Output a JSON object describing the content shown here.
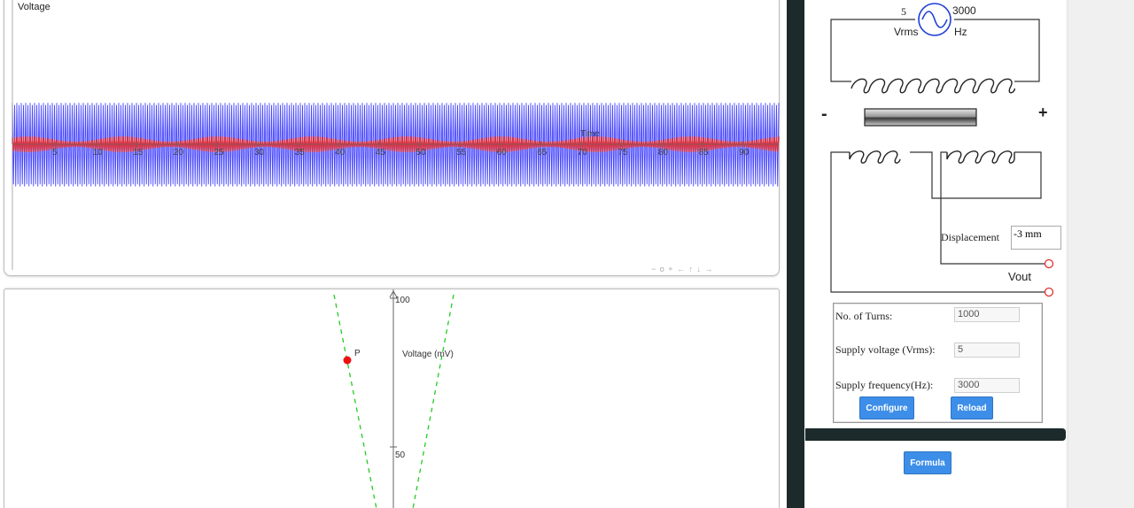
{
  "top_plot": {
    "title": "Voltage",
    "x_axis_label": "Time",
    "x_ticks": [
      "5",
      "10",
      "15",
      "20",
      "25",
      "30",
      "35",
      "40",
      "45",
      "50",
      "55",
      "60",
      "65",
      "70",
      "75",
      "80",
      "85",
      "90"
    ],
    "nav_controls": "− o + ← ↑ ↓ →"
  },
  "bottom_plot": {
    "y_axis_label": "Voltage (mV)",
    "y_ticks": [
      "100",
      "50"
    ],
    "point_label": "P"
  },
  "circuit": {
    "supply_voltage_value": "5",
    "supply_voltage_unit": "Vrms",
    "supply_freq_value": "3000",
    "supply_freq_unit": "Hz",
    "minus_sign": "-",
    "plus_sign": "+",
    "displacement_label": "Displacement",
    "displacement_value": "-3 mm",
    "vout_label": "Vout"
  },
  "config": {
    "turns_label": "No. of Turns:",
    "turns_value": "1000",
    "voltage_label": "Supply voltage (Vrms):",
    "voltage_value": "5",
    "freq_label": "Supply frequency(Hz):",
    "freq_value": "3000",
    "configure_label": "Configure",
    "reload_label": "Reload",
    "formula_label": "Formula"
  },
  "colors": {
    "wave_blue": "#3333ff",
    "wave_red": "#e0303a",
    "dash_green": "#22cc22",
    "point_red": "#ee1111",
    "source_blue": "#1f3fd6",
    "button_blue": "#3d8ee8",
    "terminal_red": "#e03030"
  }
}
